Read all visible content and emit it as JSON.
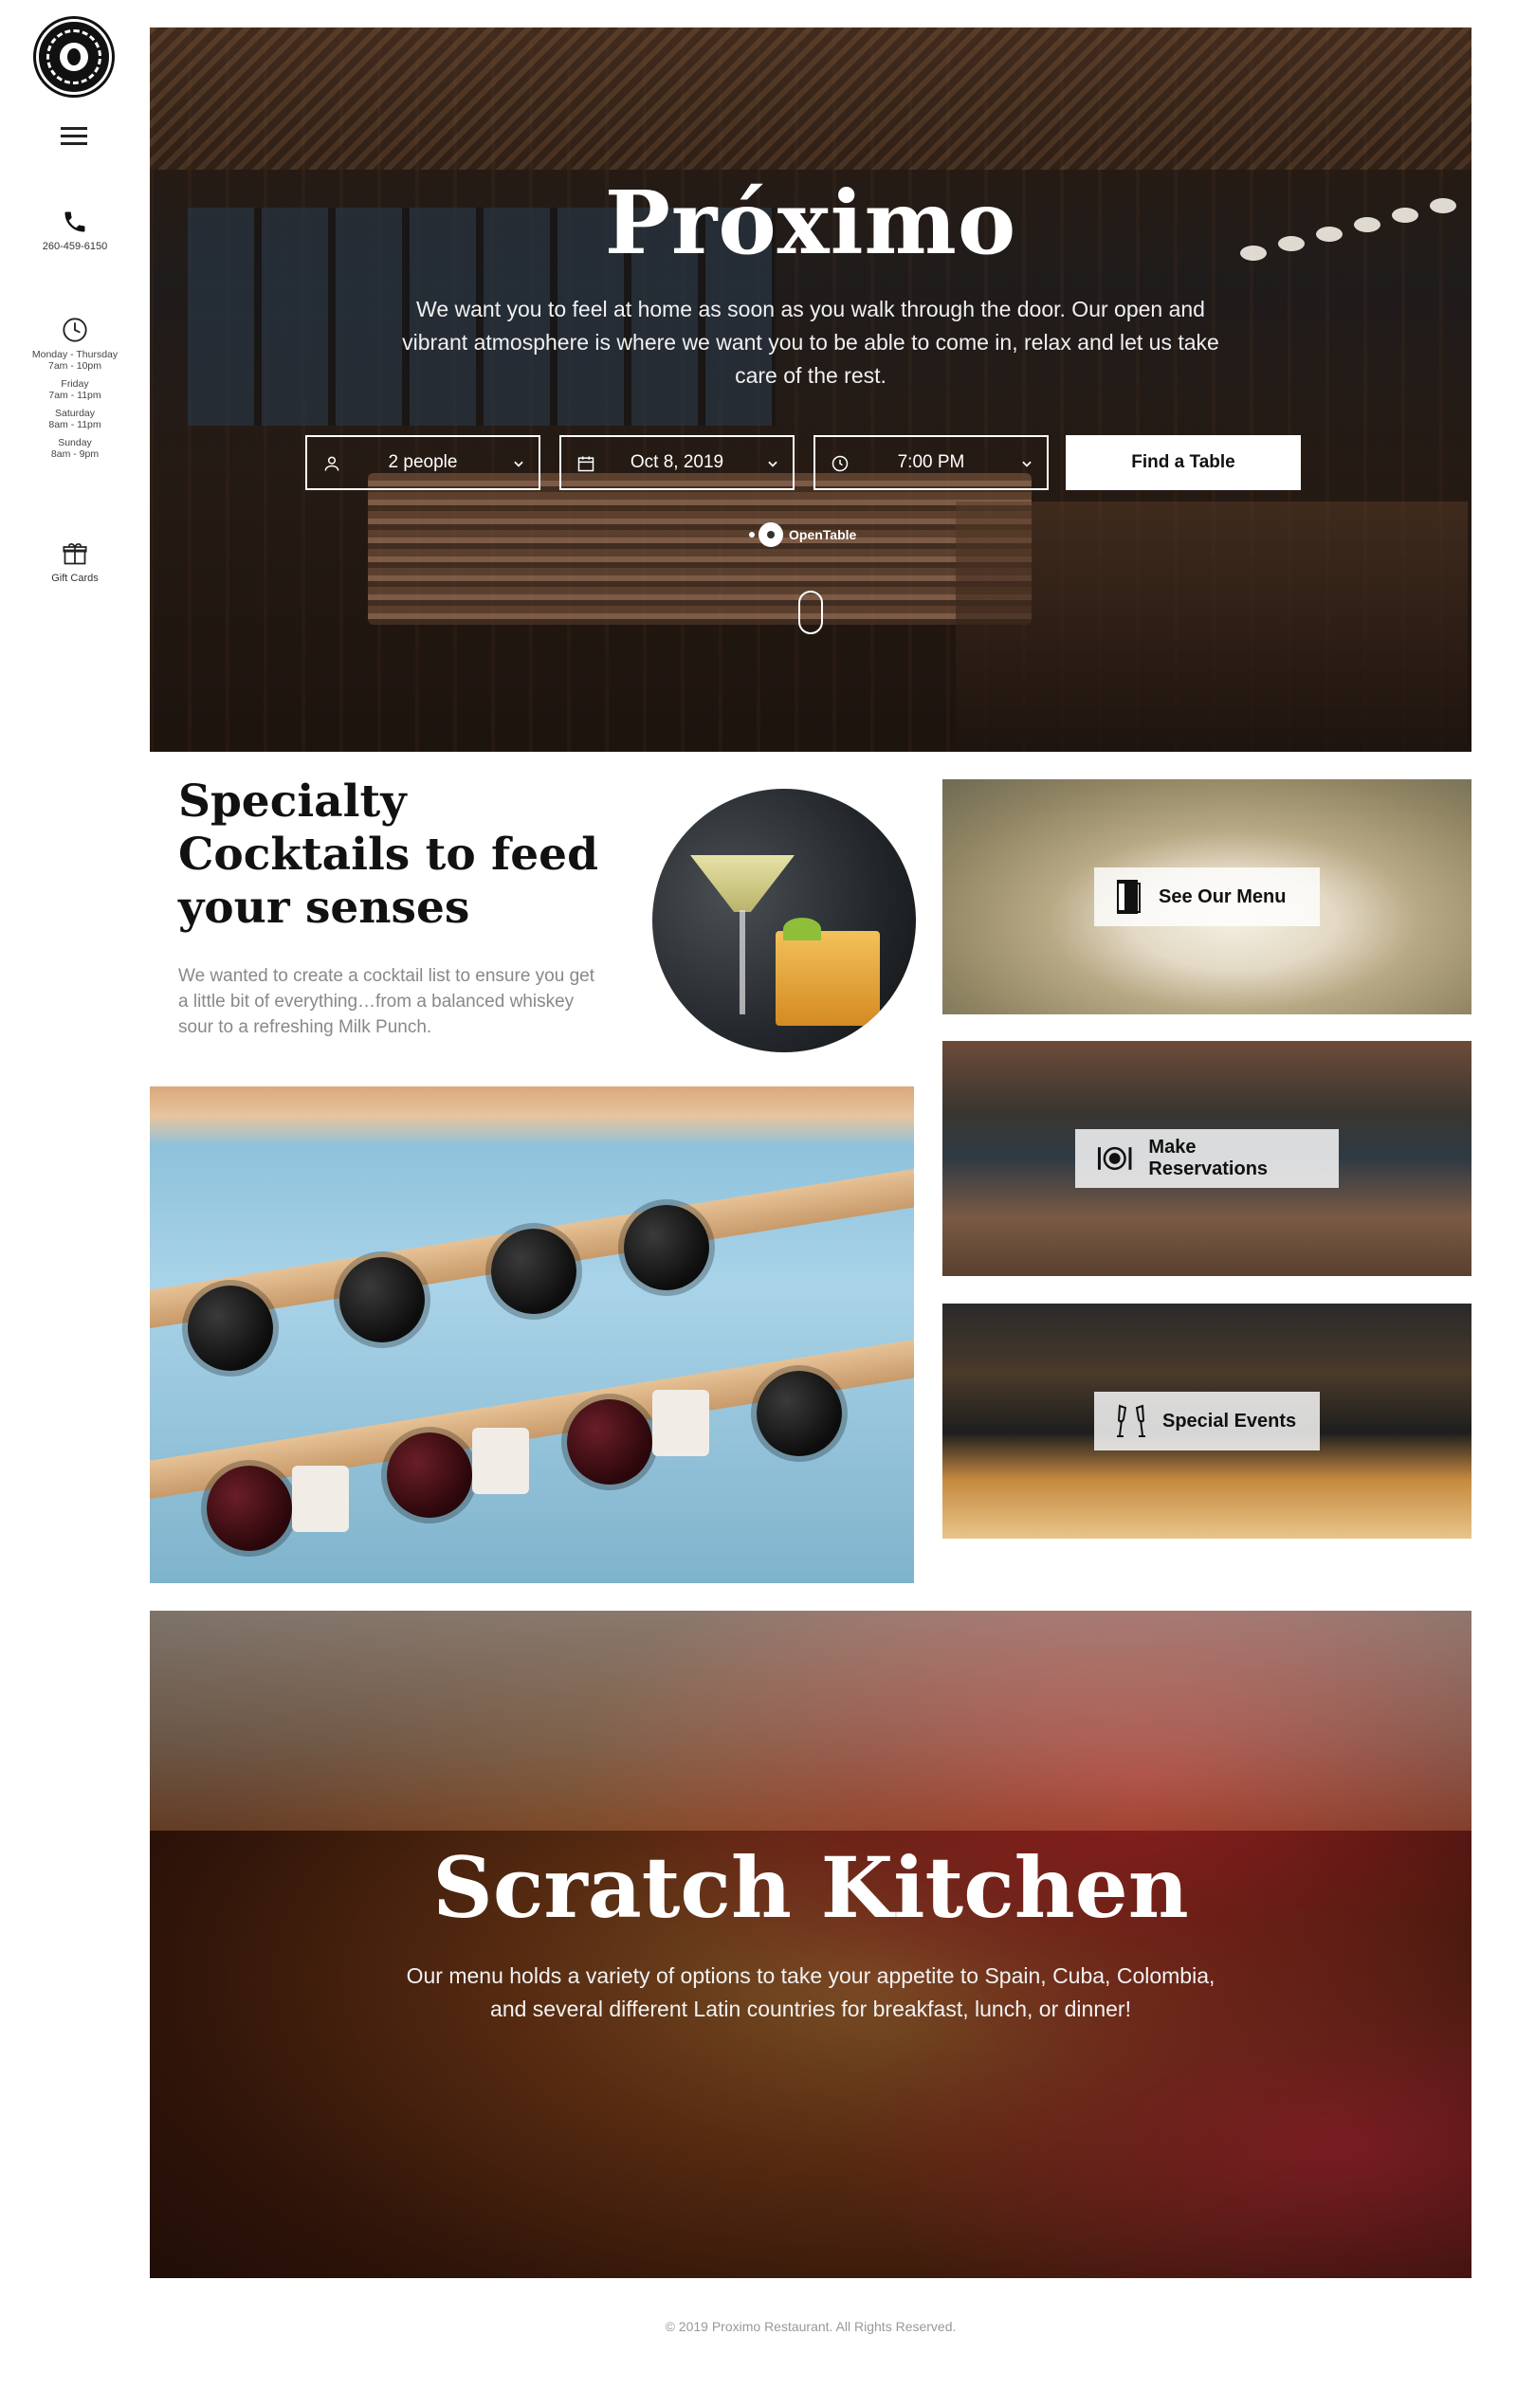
{
  "sidebar": {
    "phone": "260-459-6150",
    "hours": [
      {
        "days": "Monday - Thursday",
        "time": "7am - 10pm"
      },
      {
        "days": "Friday",
        "time": "7am - 11pm"
      },
      {
        "days": "Saturday",
        "time": "8am - 11pm"
      },
      {
        "days": "Sunday",
        "time": "8am - 9pm"
      }
    ],
    "gift_cards": "Gift Cards"
  },
  "hero": {
    "title": "Próximo",
    "description": "We want you to feel at home as soon as you walk through the door. Our open and vibrant atmosphere is where we want you to be able to come in, relax and let us take care of the rest.",
    "reservation": {
      "party_size": "2 people",
      "date": "Oct 8, 2019",
      "time": "7:00 PM",
      "button": "Find a Table"
    },
    "powered_by": "OpenTable"
  },
  "cocktails": {
    "title": "Specialty Cocktails to feed your senses",
    "description": "We wanted to create a cocktail list to ensure you get a little bit of everything…from a balanced whiskey sour to a refreshing Milk Punch."
  },
  "tiles": [
    {
      "label": "See Our Menu",
      "icon": "menu-booklet-icon"
    },
    {
      "label": "Make Reservations",
      "icon": "plate-cutlery-icon"
    },
    {
      "label": "Special Events",
      "icon": "champagne-glasses-icon"
    }
  ],
  "kitchen": {
    "title": "Scratch Kitchen",
    "description": "Our menu holds a variety of options to take your appetite to Spain, Cuba, Colombia, and several different Latin countries for breakfast, lunch, or dinner!"
  },
  "footer": {
    "copyright": "© 2019 Proximo Restaurant. All Rights Reserved."
  }
}
